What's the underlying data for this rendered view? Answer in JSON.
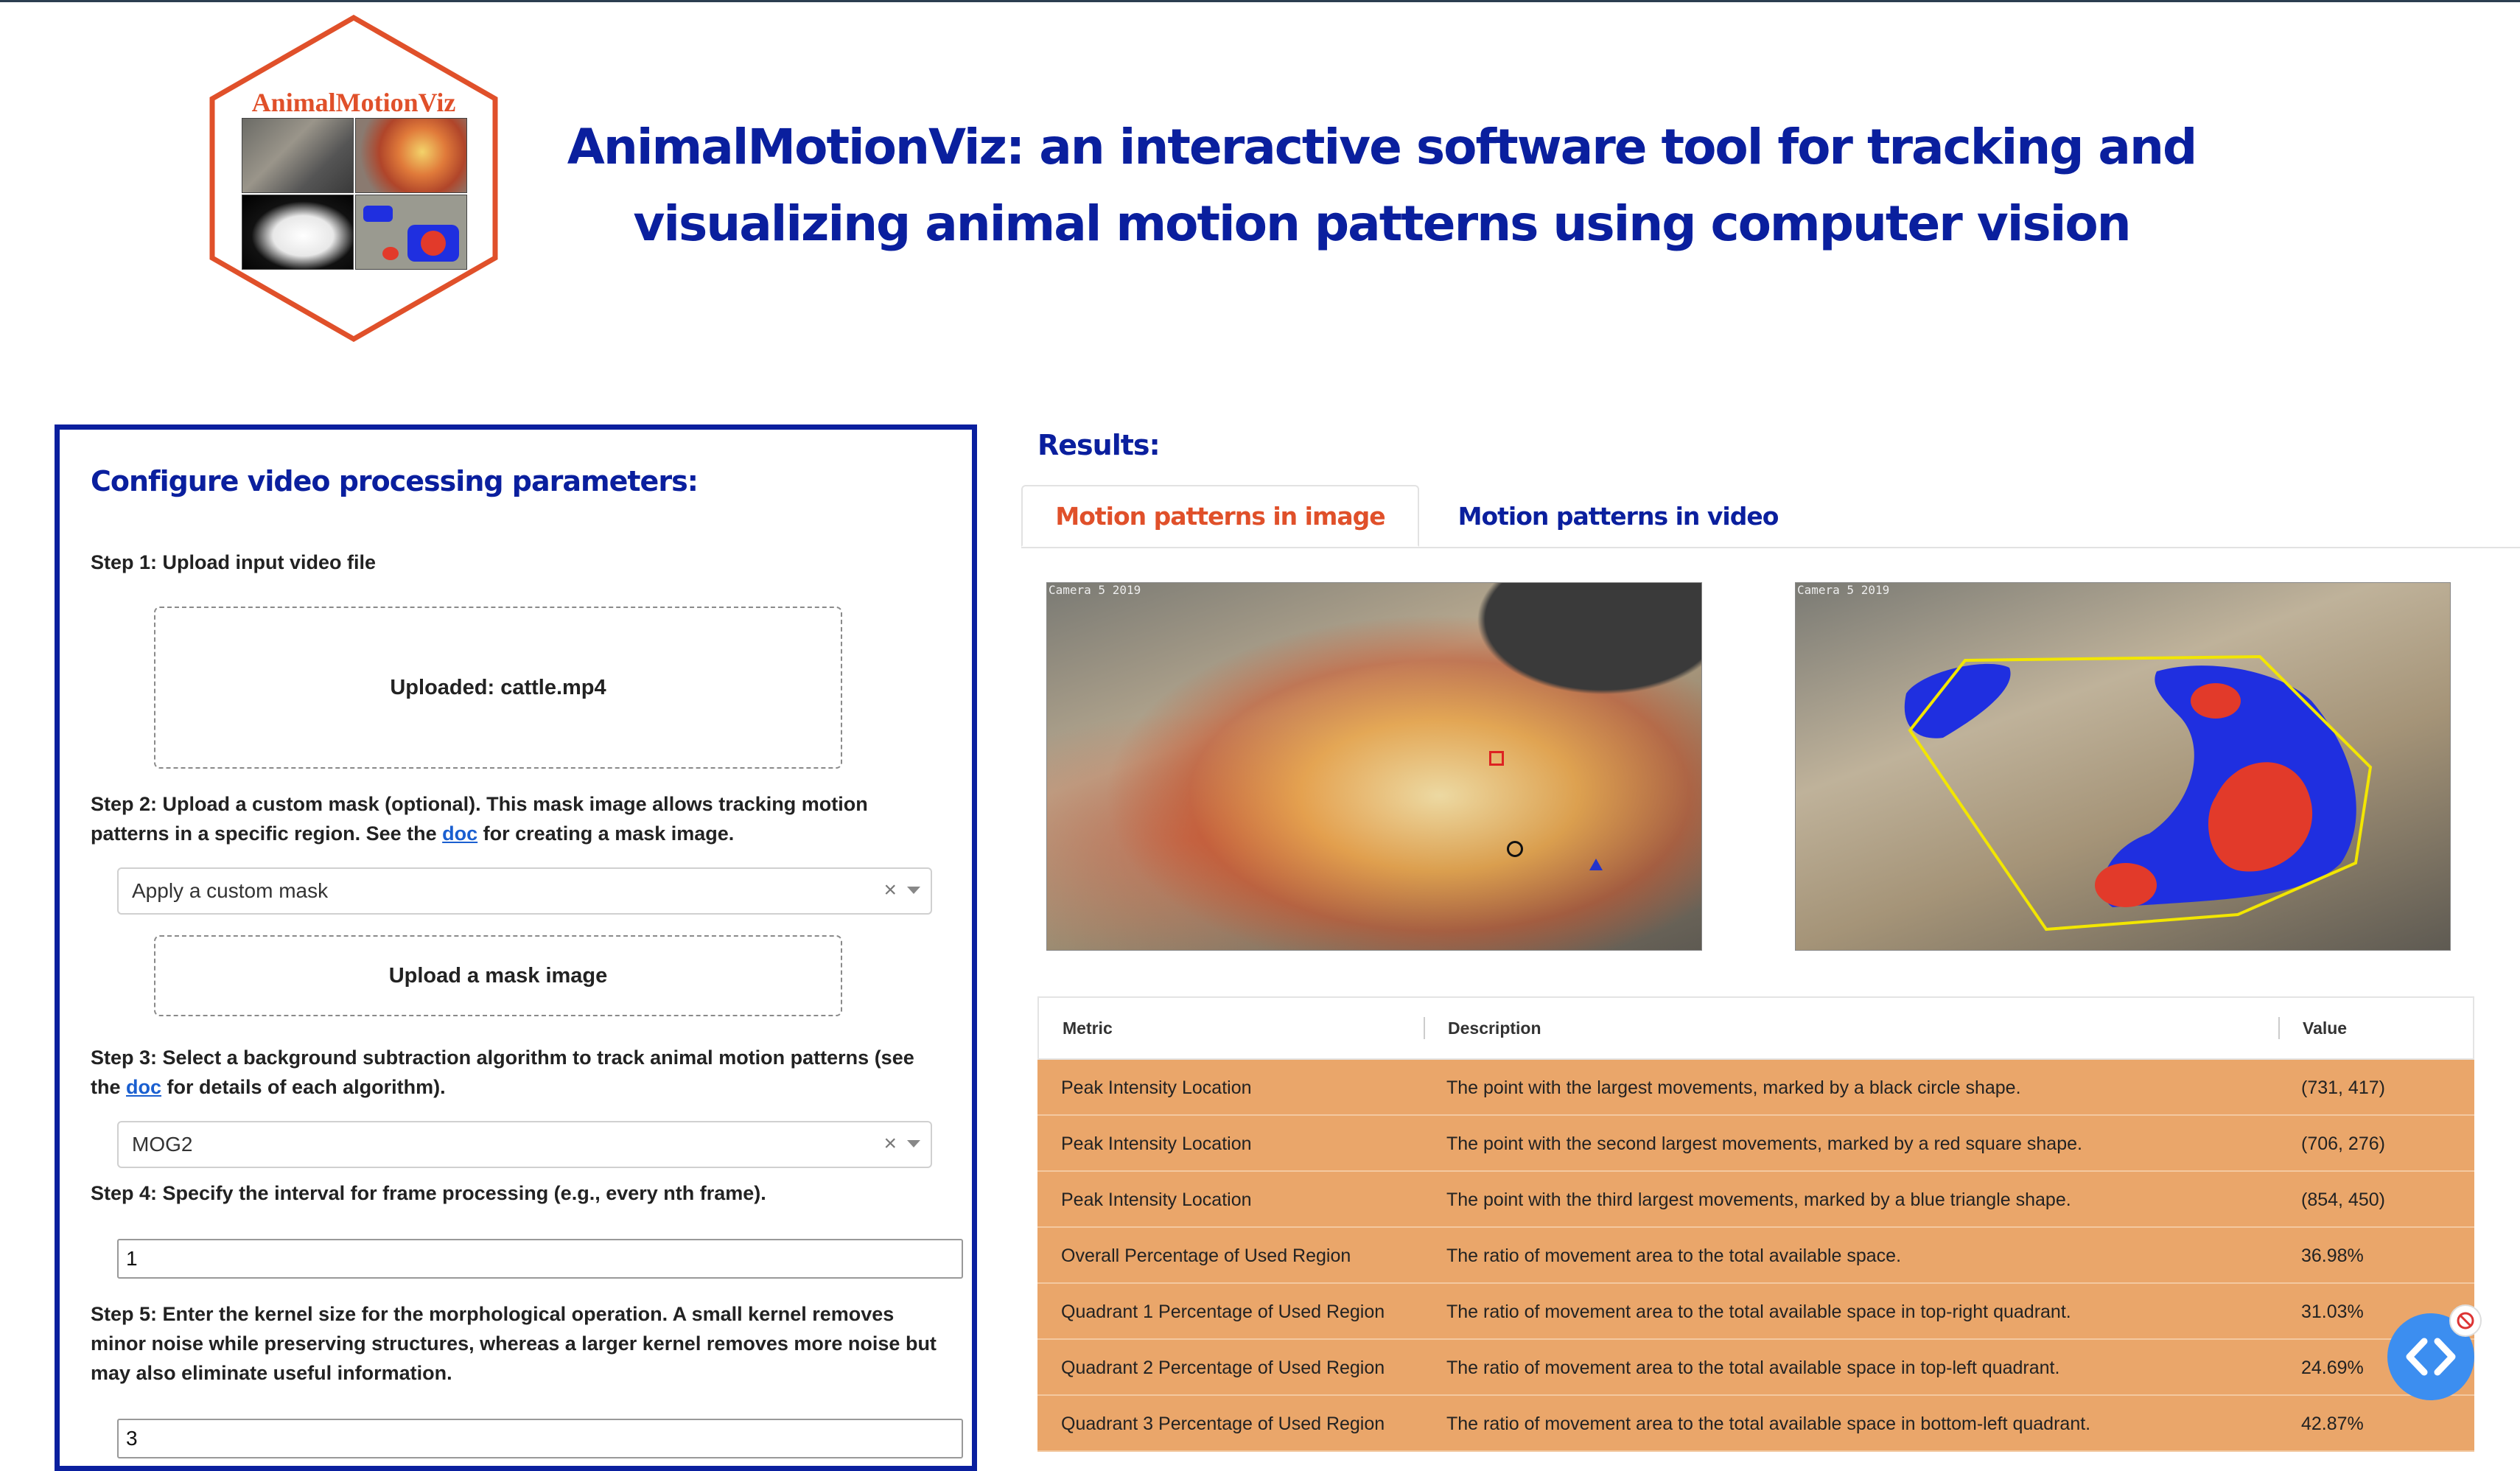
{
  "logo": {
    "text": "AnimalMotionViz"
  },
  "header": {
    "title": "AnimalMotionViz: an interactive software tool for tracking and visualizing animal motion patterns using computer vision"
  },
  "config": {
    "title": "Configure video processing parameters:",
    "step1": {
      "label": "Step 1: Upload input video file",
      "upload_status": "Uploaded: cattle.mp4"
    },
    "step2": {
      "label_before": "Step 2: Upload a custom mask (optional). This mask image allows tracking motion patterns in a specific region. See the ",
      "link": "doc",
      "label_after": " for creating a mask image.",
      "select_value": "Apply a custom mask",
      "upload_label": "Upload a mask image"
    },
    "step3": {
      "label_before": "Step 3: Select a background subtraction algorithm to track animal motion patterns (see the ",
      "link": "doc",
      "label_after": " for details of each algorithm).",
      "select_value": "MOG2"
    },
    "step4": {
      "label": "Step 4: Specify the interval for frame processing (e.g., every nth frame).",
      "value": "1"
    },
    "step5": {
      "label": "Step 5: Enter the kernel size for the morphological operation. A small kernel removes minor noise while preserving structures, whereas a larger kernel removes more noise but may also eliminate useful information.",
      "value": "3"
    }
  },
  "results": {
    "title": "Results:",
    "tabs": [
      {
        "label": "Motion patterns in image",
        "active": true
      },
      {
        "label": "Motion patterns in video",
        "active": false
      }
    ],
    "image_caption_left": "Camera 5 2019",
    "image_caption_right": "Camera 5 2019"
  },
  "table": {
    "headers": [
      "Metric",
      "Description",
      "Value"
    ],
    "rows": [
      [
        "Peak Intensity Location",
        "The point with the largest movements, marked by a black circle shape.",
        "(731, 417)"
      ],
      [
        "Peak Intensity Location",
        "The point with the second largest movements, marked by a red square shape.",
        "(706, 276)"
      ],
      [
        "Peak Intensity Location",
        "The point with the third largest movements, marked by a blue triangle shape.",
        "(854, 450)"
      ],
      [
        "Overall Percentage of Used Region",
        "The ratio of movement area to the total available space.",
        "36.98%"
      ],
      [
        "Quadrant 1 Percentage of Used Region",
        "The ratio of movement area to the total available space in top-right quadrant.",
        "31.03%"
      ],
      [
        "Quadrant 2 Percentage of Used Region",
        "The ratio of movement area to the total available space in top-left quadrant.",
        "24.69%"
      ],
      [
        "Quadrant 3 Percentage of Used Region",
        "The ratio of movement area to the total available space in bottom-left quadrant.",
        "42.87%"
      ]
    ],
    "row_color": "#eaa66a"
  },
  "colors": {
    "brand_blue": "#0a1f9e",
    "accent_orange": "#e0502a",
    "link": "#1a5fd0"
  },
  "icons": {
    "fab": "code-brackets-icon",
    "clear": "clear-icon",
    "caret": "chevron-down-icon"
  }
}
